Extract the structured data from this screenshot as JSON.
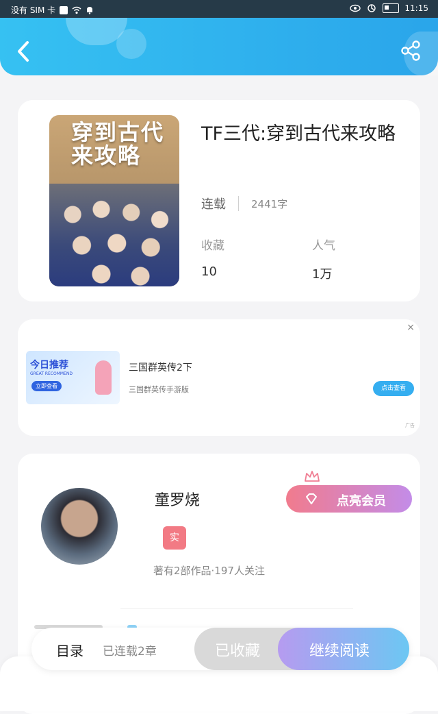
{
  "status_bar": {
    "carrier": "没有 SIM 卡",
    "time": "11:15",
    "battery": "22"
  },
  "header": {
    "back_icon": "chevron-left-icon",
    "share_icon": "share-icon"
  },
  "book": {
    "cover_title": "穿到古代来攻略",
    "title": "TF三代:穿到古代来攻略",
    "status": "连载",
    "word_count": "2441字",
    "stats": [
      {
        "label": "收藏",
        "value": "10"
      },
      {
        "label": "人气",
        "value": "1万"
      }
    ]
  },
  "ad": {
    "close": "×",
    "image_title": "今日推荐",
    "image_subtitle": "GREAT RECOMMEND",
    "image_button": "立即查看",
    "title": "三国群英传2下",
    "description": "三国群英传手游版",
    "button": "点击查看",
    "source": "广告"
  },
  "author": {
    "name": "童罗烧",
    "badge": "实",
    "meta": "著有2部作品·197人关注",
    "vip_button": "点亮会员"
  },
  "bottom_bar": {
    "toc": "目录",
    "serial": "已连载2章",
    "collected": "已收藏",
    "continue": "继续阅读"
  }
}
